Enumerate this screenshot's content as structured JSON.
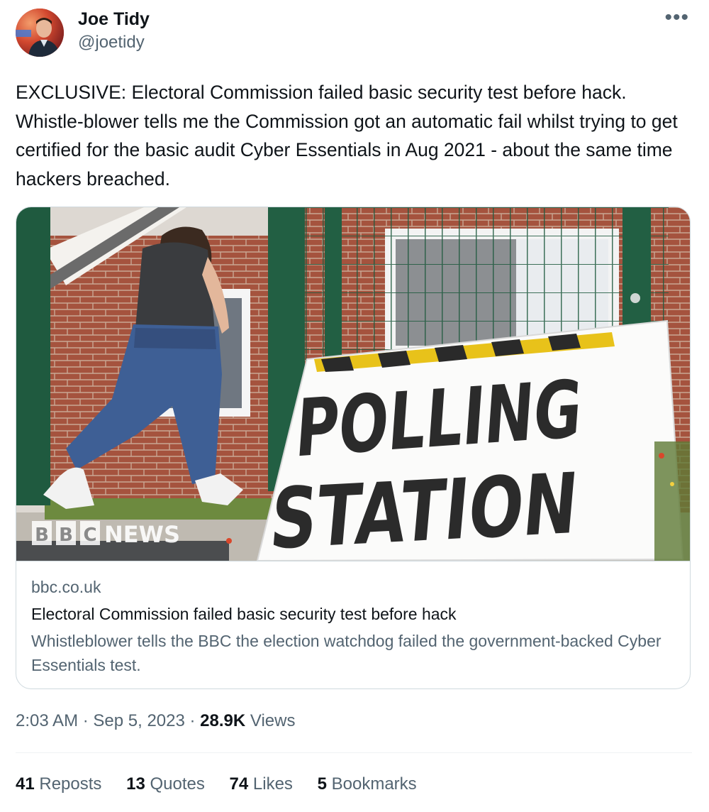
{
  "author": {
    "display_name": "Joe Tidy",
    "handle": "@joetidy"
  },
  "more_icon": "more-horizontal-icon",
  "tweet": {
    "text": "EXCLUSIVE: Electoral Commission failed basic security test before hack. Whistle-blower tells me the Commission got an automatic fail whilst trying to get certified for the basic audit Cyber Essentials in Aug 2021 - about the same time hackers breached."
  },
  "card": {
    "image": {
      "sign_line1": "POLLING",
      "sign_line2": "STATION",
      "logo_letters": [
        "B",
        "B",
        "C"
      ],
      "logo_word": "NEWS"
    },
    "domain": "bbc.co.uk",
    "title": "Electoral Commission failed basic security test before hack",
    "description": "Whistleblower tells the BBC the election watchdog failed the government-backed Cyber Essentials test."
  },
  "meta": {
    "time": "2:03 AM",
    "separator": " · ",
    "date": "Sep 5, 2023",
    "views_count": "28.9K",
    "views_label": " Views"
  },
  "stats": [
    {
      "count": "41",
      "label": " Reposts"
    },
    {
      "count": "13",
      "label": " Quotes"
    },
    {
      "count": "74",
      "label": " Likes"
    },
    {
      "count": "5",
      "label": " Bookmarks"
    }
  ],
  "colors": {
    "text_primary": "#0f1419",
    "text_secondary": "#536471",
    "border": "#cfd9de"
  }
}
